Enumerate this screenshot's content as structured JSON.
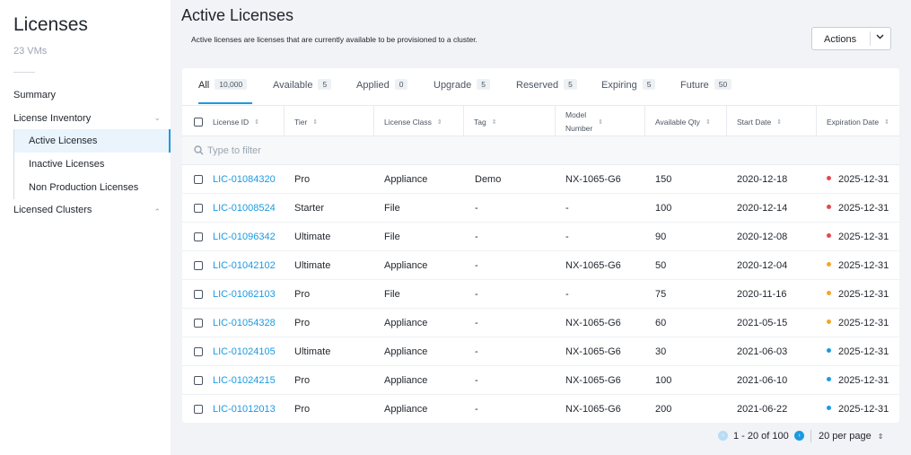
{
  "sidebar": {
    "title": "Licenses",
    "subtitle": "23 VMs",
    "summary": "Summary",
    "license_inventory": "License Inventory",
    "sub_items": [
      "Active Licenses",
      "Inactive Licenses",
      "Non Production Licenses"
    ],
    "licensed_clusters": "Licensed Clusters",
    "chevron_down": "⌄",
    "chevron_up": "⌃"
  },
  "header": {
    "title": "Active Licenses",
    "description": "Active licenses are licenses that are currently available to be provisioned to a cluster.",
    "actions_label": "Actions"
  },
  "tabs": [
    {
      "label": "All",
      "count": "10,000"
    },
    {
      "label": "Available",
      "count": "5"
    },
    {
      "label": "Applied",
      "count": "0"
    },
    {
      "label": "Upgrade",
      "count": "5"
    },
    {
      "label": "Reserved",
      "count": "5"
    },
    {
      "label": "Expiring",
      "count": "5"
    },
    {
      "label": "Future",
      "count": "50"
    }
  ],
  "columns": [
    "License ID",
    "Tier",
    "License Class",
    "Tag",
    "Model Number",
    "Available Qty",
    "Start Date",
    "Expiration Date"
  ],
  "model_number_lines": [
    "Model",
    "Number"
  ],
  "filter": {
    "placeholder": "Type to filter",
    "value": ""
  },
  "rows": [
    {
      "id": "LIC-01084320",
      "tier": "Pro",
      "class": "Appliance",
      "tag": "Demo",
      "model": "NX-1065-G6",
      "qty": "150",
      "start": "2020-12-18",
      "exp": "2025-12-31",
      "status_color": "#e5484d"
    },
    {
      "id": "LIC-01008524",
      "tier": "Starter",
      "class": "File",
      "tag": "-",
      "model": "-",
      "qty": "100",
      "start": "2020-12-14",
      "exp": "2025-12-31",
      "status_color": "#e5484d"
    },
    {
      "id": "LIC-01096342",
      "tier": "Ultimate",
      "class": "File",
      "tag": "-",
      "model": "-",
      "qty": "90",
      "start": "2020-12-08",
      "exp": "2025-12-31",
      "status_color": "#e5484d"
    },
    {
      "id": "LIC-01042102",
      "tier": "Ultimate",
      "class": "Appliance",
      "tag": "-",
      "model": "NX-1065-G6",
      "qty": "50",
      "start": "2020-12-04",
      "exp": "2025-12-31",
      "status_color": "#f5a623"
    },
    {
      "id": "LIC-01062103",
      "tier": "Pro",
      "class": "File",
      "tag": "-",
      "model": "-",
      "qty": "75",
      "start": "2020-11-16",
      "exp": "2025-12-31",
      "status_color": "#f5a623"
    },
    {
      "id": "LIC-01054328",
      "tier": "Pro",
      "class": "Appliance",
      "tag": "-",
      "model": "NX-1065-G6",
      "qty": "60",
      "start": "2021-05-15",
      "exp": "2025-12-31",
      "status_color": "#f5a623"
    },
    {
      "id": "LIC-01024105",
      "tier": "Ultimate",
      "class": "Appliance",
      "tag": "-",
      "model": "NX-1065-G6",
      "qty": "30",
      "start": "2021-06-03",
      "exp": "2025-12-31",
      "status_color": "#1b9ae2"
    },
    {
      "id": "LIC-01024215",
      "tier": "Pro",
      "class": "Appliance",
      "tag": "-",
      "model": "NX-1065-G6",
      "qty": "100",
      "start": "2021-06-10",
      "exp": "2025-12-31",
      "status_color": "#1b9ae2"
    },
    {
      "id": "LIC-01012013",
      "tier": "Pro",
      "class": "Appliance",
      "tag": "-",
      "model": "NX-1065-G6",
      "qty": "200",
      "start": "2021-06-22",
      "exp": "2025-12-31",
      "status_color": "#1b9ae2"
    }
  ],
  "pagination": {
    "range": "1 - 20 of 100",
    "per_page": "20 per page",
    "prev_icon": "‹",
    "next_icon": "›"
  },
  "colors": {
    "accent": "#1b9ae2",
    "text": "#22272e",
    "muted": "#9aa5b1",
    "background": "#f1f3f6"
  }
}
